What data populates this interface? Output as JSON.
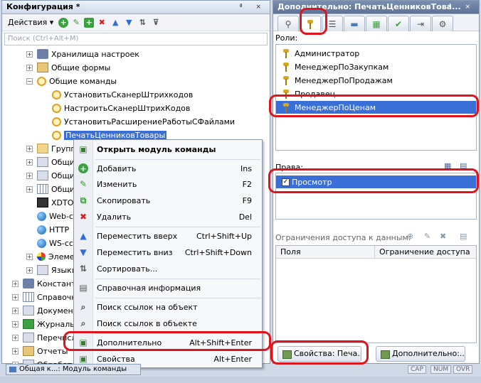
{
  "left_panel": {
    "title": "Конфигурация *",
    "title_buttons": "ª ×",
    "actions_label": "Действия ▾",
    "search_placeholder": "Поиск (Ctrl+Alt+M)",
    "tree": [
      {
        "label": "Хранилища настроек",
        "icon": "storage-icon"
      },
      {
        "label": "Общие формы",
        "icon": "form-icon"
      },
      {
        "label": "Общие команды",
        "icon": "command-icon",
        "expanded": true
      },
      {
        "label": "УстановитьСканерШтрихкодов",
        "icon": "command-icon"
      },
      {
        "label": "НастроитьСканерШтрихКодов",
        "icon": "command-icon"
      },
      {
        "label": "УстановитьРасширениеРаботыСФайлами",
        "icon": "command-icon"
      },
      {
        "label": "ПечатьЦенниковТовары",
        "icon": "command-icon",
        "selected": true
      },
      {
        "label": "Групп",
        "icon": "folder-icon"
      },
      {
        "label": "Общи",
        "icon": "doc-icon"
      },
      {
        "label": "Общи",
        "icon": "doc-icon"
      },
      {
        "label": "Общи",
        "icon": "doc-icon"
      },
      {
        "label": "XDTO",
        "icon": "xdto-icon"
      },
      {
        "label": "Web-с",
        "icon": "globe-icon"
      },
      {
        "label": "HTTP",
        "icon": "globe-icon"
      },
      {
        "label": "WS-сс",
        "icon": "globe-icon"
      },
      {
        "label": "Элеме",
        "icon": "style-icon"
      },
      {
        "label": "Языки",
        "icon": "lang-icon"
      },
      {
        "label": "Констант",
        "icon": "const-icon"
      },
      {
        "label": "Справочн",
        "icon": "catalog-icon"
      },
      {
        "label": "Докумен",
        "icon": "document-icon"
      },
      {
        "label": "Журналы",
        "icon": "journal-icon"
      },
      {
        "label": "Перечисл",
        "icon": "enum-icon"
      },
      {
        "label": "Отчеты",
        "icon": "report-icon"
      },
      {
        "label": "Обработ",
        "icon": "processing-icon"
      }
    ]
  },
  "context_menu": [
    {
      "label": "Открыть модуль команды",
      "key": "",
      "icon": "open-module-icon",
      "bold": true
    },
    {
      "label": "Добавить",
      "key": "Ins",
      "icon": "add-icon"
    },
    {
      "label": "Изменить",
      "key": "F2",
      "icon": "edit-icon"
    },
    {
      "label": "Скопировать",
      "key": "F9",
      "icon": "copy-icon"
    },
    {
      "label": "Удалить",
      "key": "Del",
      "icon": "delete-icon"
    },
    {
      "label": "Переместить вверх",
      "key": "Ctrl+Shift+Up",
      "icon": "move-up-icon"
    },
    {
      "label": "Переместить вниз",
      "key": "Ctrl+Shift+Down",
      "icon": "move-down-icon"
    },
    {
      "label": "Сортировать...",
      "key": "",
      "icon": "sort-icon"
    },
    {
      "label": "Справочная информация",
      "key": "",
      "icon": "help-icon"
    },
    {
      "label": "Поиск ссылок на объект",
      "key": "",
      "icon": "find-refs-to-icon"
    },
    {
      "label": "Поиск ссылок в объекте",
      "key": "",
      "icon": "find-refs-in-icon"
    },
    {
      "label": "Дополнительно",
      "key": "Alt+Shift+Enter",
      "icon": "additional-icon"
    },
    {
      "label": "Свойства",
      "key": "Alt+Enter",
      "icon": "properties-icon"
    }
  ],
  "right_panel": {
    "title": "Дополнительно: ПечатьЦенниковТова...",
    "title_buttons": "ª ×",
    "roles_label": "Роли:",
    "roles": [
      {
        "label": "Администратор",
        "selected": false
      },
      {
        "label": "МенеджерПоЗакупкам",
        "selected": false
      },
      {
        "label": "МенеджерПоПродажам",
        "selected": false
      },
      {
        "label": "Продавец",
        "selected": false
      },
      {
        "label": "МенеджерПоЦенам",
        "selected": true
      }
    ],
    "rights_label": "Права:",
    "rights": [
      {
        "label": "Просмотр",
        "checked": true,
        "check_glyph": "✓"
      }
    ],
    "restrictions_label": "Ограничения доступа к данным:",
    "columns": [
      "Поля",
      "Ограничение доступа"
    ],
    "bottom_tabs": [
      "Свойства: Печа...",
      "Дополнительно:..."
    ]
  },
  "status_bar": {
    "tab_label": "Общая к...: Модуль команды",
    "indicators": [
      "CAP",
      "NUM",
      "OVR"
    ]
  }
}
